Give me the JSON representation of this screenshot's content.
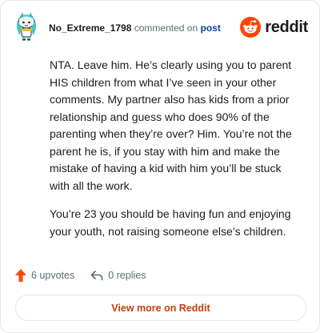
{
  "comment": {
    "author": "No_Extreme_1798",
    "action_text": "commented on",
    "post_link": "post",
    "body_paragraphs": [
      "NTA. Leave him. He’s clearly using you to parent HIS children from what I’ve seen in your other comments. My partner also has kids from a prior relationship and guess who does 90% of the parenting when they’re over? Him. You’re not the parent he is, if you stay with him and make the mistake of having a kid with him you’ll be stuck with all the work.",
      "You’re 23 you should be having fun and enjoying your youth, not raising someone else’s children."
    ],
    "upvotes_label": "6 upvotes",
    "replies_label": "0 replies"
  },
  "brand": {
    "name": "reddit",
    "icon": "reddit-logo-icon",
    "color": "#ff4500"
  },
  "actions": {
    "view_more_label": "View more on Reddit"
  },
  "colors": {
    "upvote": "#ff4500",
    "link": "#0a449b",
    "view_more": "#c2410c"
  }
}
